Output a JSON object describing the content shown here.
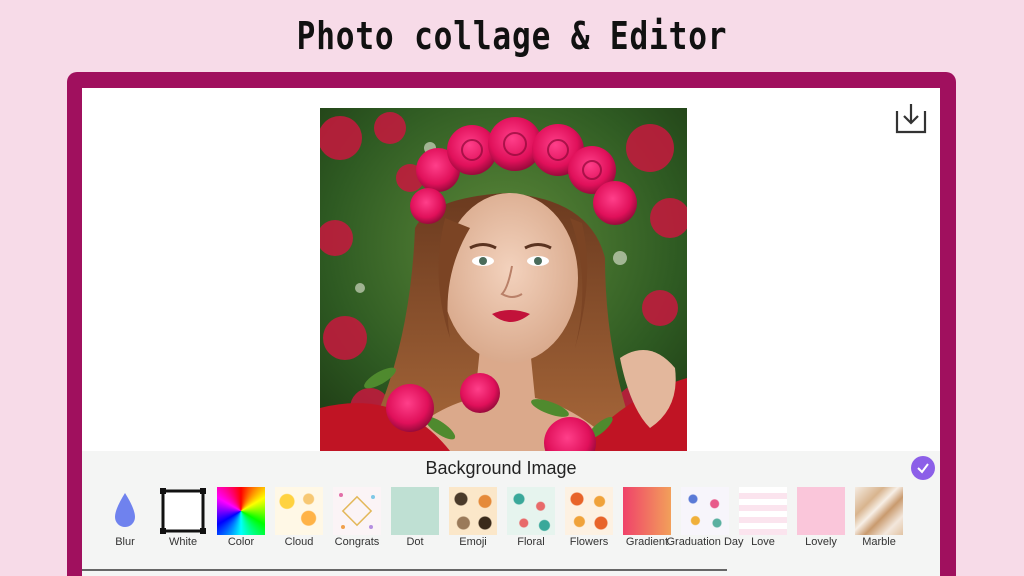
{
  "headline": "Photo collage & Editor",
  "toolbar": {
    "download_icon": "download-icon"
  },
  "panel": {
    "title": "Background Image",
    "confirm_icon": "checkmark-icon",
    "accent": "#8c5fe8"
  },
  "backgrounds": [
    {
      "label": "Blur"
    },
    {
      "label": "White"
    },
    {
      "label": "Color"
    },
    {
      "label": "Cloud"
    },
    {
      "label": "Congrats"
    },
    {
      "label": "Dot"
    },
    {
      "label": "Emoji"
    },
    {
      "label": "Floral"
    },
    {
      "label": "Flowers"
    },
    {
      "label": "Gradient"
    },
    {
      "label": "Graduation Day"
    },
    {
      "label": "Love"
    },
    {
      "label": "Lovely"
    },
    {
      "label": "Marble"
    }
  ],
  "colors": {
    "page_background": "#f7dbe8",
    "device_frame": "#a0105e"
  }
}
